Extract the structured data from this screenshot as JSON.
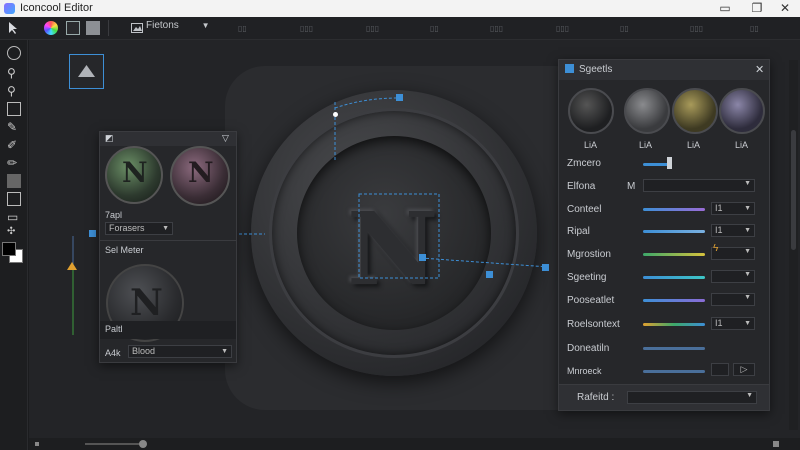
{
  "window": {
    "title": "Iconcool Editor"
  },
  "toolbar": {
    "dropdown_label": "Fietons"
  },
  "layers_panel": {
    "row1_label": "7apl",
    "row2_value": "Forasers",
    "section_title": "Sel Meter",
    "footer_label": "Paltl",
    "bottom_label": "A4k",
    "bottom_value": "Blood"
  },
  "settings_panel": {
    "title": "Sgeetls",
    "swatch_labels": [
      "LiA",
      "LiA",
      "LiA",
      "LiA"
    ],
    "rows": [
      {
        "label": "Zmcero"
      },
      {
        "label": "Elfona",
        "extra": "M"
      },
      {
        "label": "Conteel",
        "value": "I1"
      },
      {
        "label": "Ripal",
        "value": "I1"
      },
      {
        "label": "Mgrostion"
      },
      {
        "label": "Sgeeting"
      },
      {
        "label": "Pooseatlet"
      },
      {
        "label": "Roelsontext",
        "value": "I1"
      },
      {
        "label": "Doneatiln"
      },
      {
        "label": "Mnroeck"
      }
    ],
    "footer_label": "Rafeitd :"
  },
  "colors": {
    "accent": "#3d8fd6",
    "fg_swatch": "#000000",
    "bg_swatch": "#ffffff"
  }
}
